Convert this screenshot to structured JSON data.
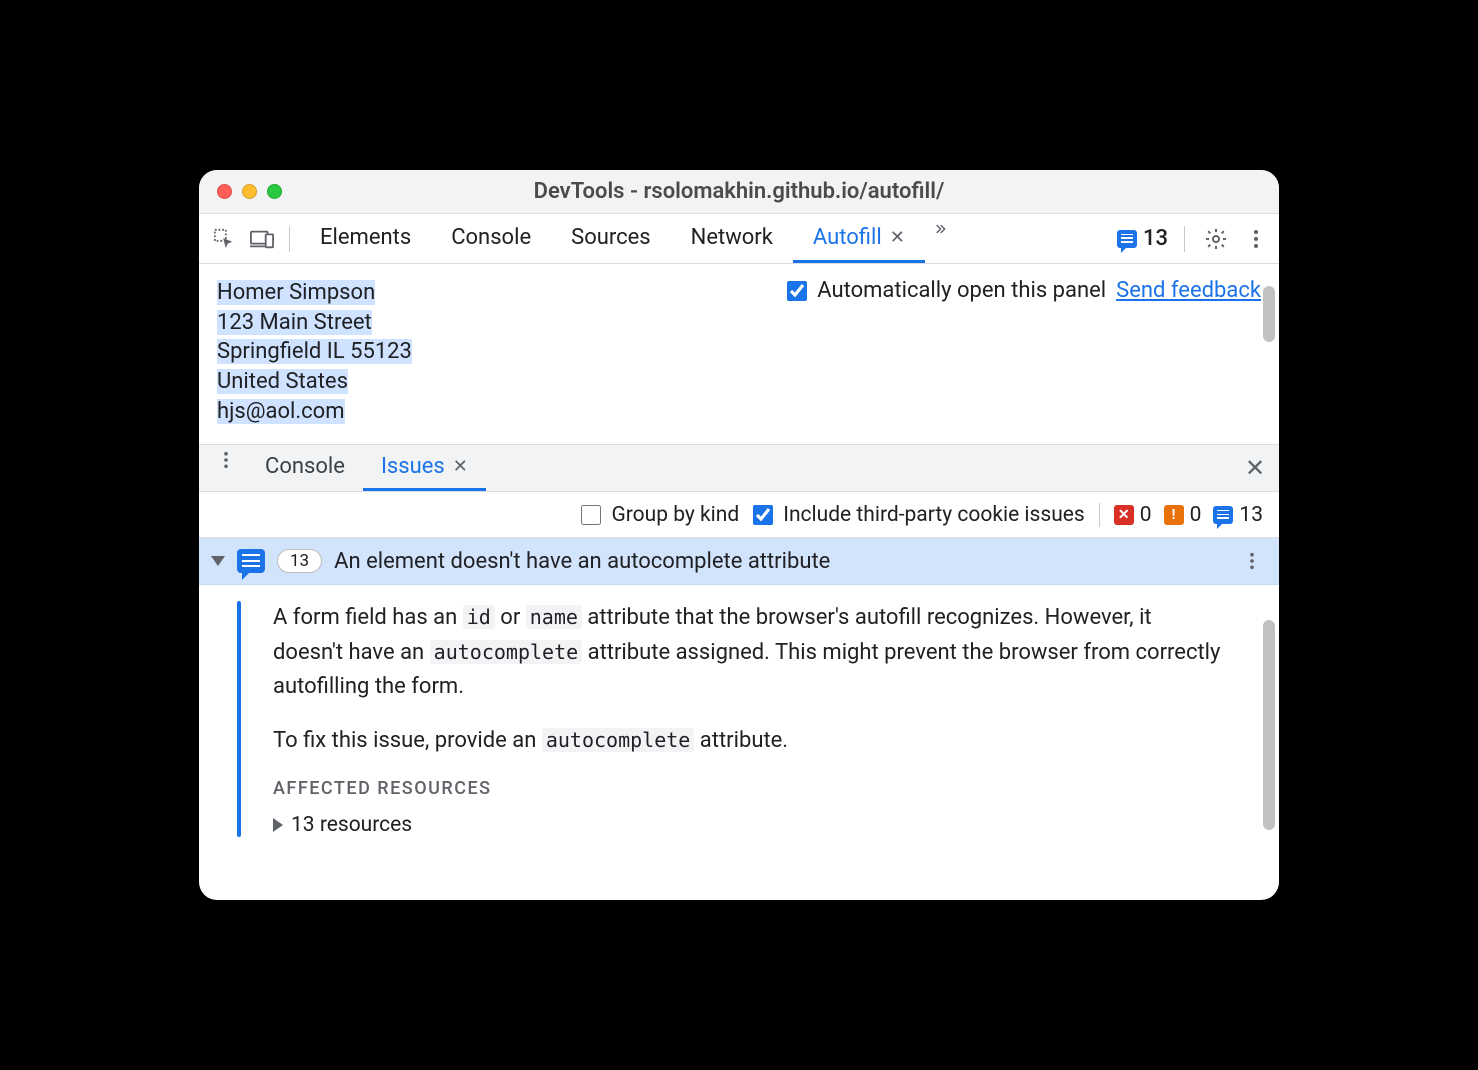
{
  "window": {
    "title": "DevTools - rsolomakhin.github.io/autofill/"
  },
  "toolbar": {
    "tabs": [
      {
        "label": "Elements",
        "active": false
      },
      {
        "label": "Console",
        "active": false
      },
      {
        "label": "Sources",
        "active": false
      },
      {
        "label": "Network",
        "active": false
      },
      {
        "label": "Autofill",
        "active": true,
        "closable": true
      }
    ],
    "issues_badge": "13"
  },
  "autofill_panel": {
    "address_lines": [
      "Homer Simpson",
      "123 Main Street",
      "Springfield IL 55123",
      "United States",
      "hjs@aol.com"
    ],
    "auto_open_checkbox": {
      "checked": true,
      "label": "Automatically open this panel"
    },
    "feedback_link": "Send feedback"
  },
  "drawer": {
    "tabs": [
      {
        "label": "Console",
        "active": false
      },
      {
        "label": "Issues",
        "active": true,
        "closable": true
      }
    ]
  },
  "issues_filters": {
    "group_by_kind": {
      "checked": false,
      "label": "Group by kind"
    },
    "include_third_party": {
      "checked": true,
      "label": "Include third-party cookie issues"
    },
    "counts": {
      "errors": "0",
      "warnings": "0",
      "info": "13"
    }
  },
  "issue": {
    "count_badge": "13",
    "title": "An element doesn't have an autocomplete attribute",
    "paragraph1_pre": "A form field has an ",
    "paragraph1_code1": "id",
    "paragraph1_mid1": " or ",
    "paragraph1_code2": "name",
    "paragraph1_mid2": " attribute that the browser's autofill recognizes. However, it doesn't have an ",
    "paragraph1_code3": "autocomplete",
    "paragraph1_post": " attribute assigned. This might prevent the browser from correctly autofilling the form.",
    "paragraph2_pre": "To fix this issue, provide an ",
    "paragraph2_code": "autocomplete",
    "paragraph2_post": " attribute.",
    "affected_heading": "AFFECTED RESOURCES",
    "resources_row": "13 resources"
  }
}
